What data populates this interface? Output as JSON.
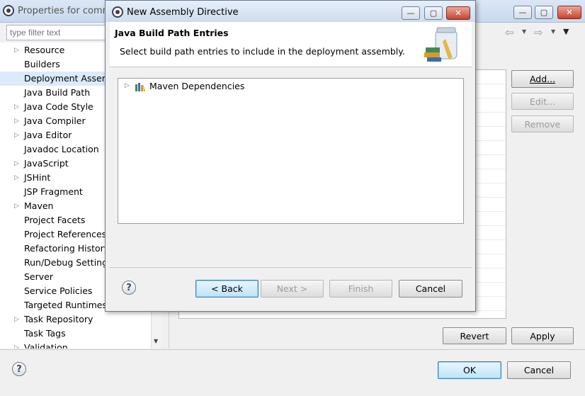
{
  "window": {
    "title": "Properties for comm",
    "min": "—",
    "max": "▢",
    "close": "✕"
  },
  "filter": {
    "placeholder": "type filter text"
  },
  "tree": {
    "items": [
      {
        "label": "Resource",
        "expandable": true
      },
      {
        "label": "Builders",
        "expandable": false
      },
      {
        "label": "Deployment Assemb",
        "expandable": false,
        "selected": true
      },
      {
        "label": "Java Build Path",
        "expandable": false
      },
      {
        "label": "Java Code Style",
        "expandable": true
      },
      {
        "label": "Java Compiler",
        "expandable": true
      },
      {
        "label": "Java Editor",
        "expandable": true
      },
      {
        "label": "Javadoc Location",
        "expandable": false
      },
      {
        "label": "JavaScript",
        "expandable": true
      },
      {
        "label": "JSHint",
        "expandable": true
      },
      {
        "label": "JSP Fragment",
        "expandable": false
      },
      {
        "label": "Maven",
        "expandable": true
      },
      {
        "label": "Project Facets",
        "expandable": false
      },
      {
        "label": "Project References",
        "expandable": false
      },
      {
        "label": "Refactoring History",
        "expandable": false
      },
      {
        "label": "Run/Debug Settings",
        "expandable": false
      },
      {
        "label": "Server",
        "expandable": false
      },
      {
        "label": "Service Policies",
        "expandable": false
      },
      {
        "label": "Targeted Runtimes",
        "expandable": false
      },
      {
        "label": "Task Repository",
        "expandable": true
      },
      {
        "label": "Task Tags",
        "expandable": false
      },
      {
        "label": "Validation",
        "expandable": true
      }
    ]
  },
  "right": {
    "add": "Add...",
    "edit": "Edit...",
    "remove": "Remove",
    "revert": "Revert",
    "apply": "Apply"
  },
  "bottom": {
    "ok": "OK",
    "cancel": "Cancel"
  },
  "dialog": {
    "title": "New Assembly Directive",
    "header_title": "Java Build Path Entries",
    "header_desc": "Select build path entries to include in the deployment assembly.",
    "entries": [
      {
        "label": "Maven Dependencies"
      }
    ],
    "back": "< Back",
    "next": "Next >",
    "finish": "Finish",
    "cancel": "Cancel"
  },
  "colors": {
    "selection": "#dceafc",
    "default_button_border": "#3c7fb1"
  }
}
